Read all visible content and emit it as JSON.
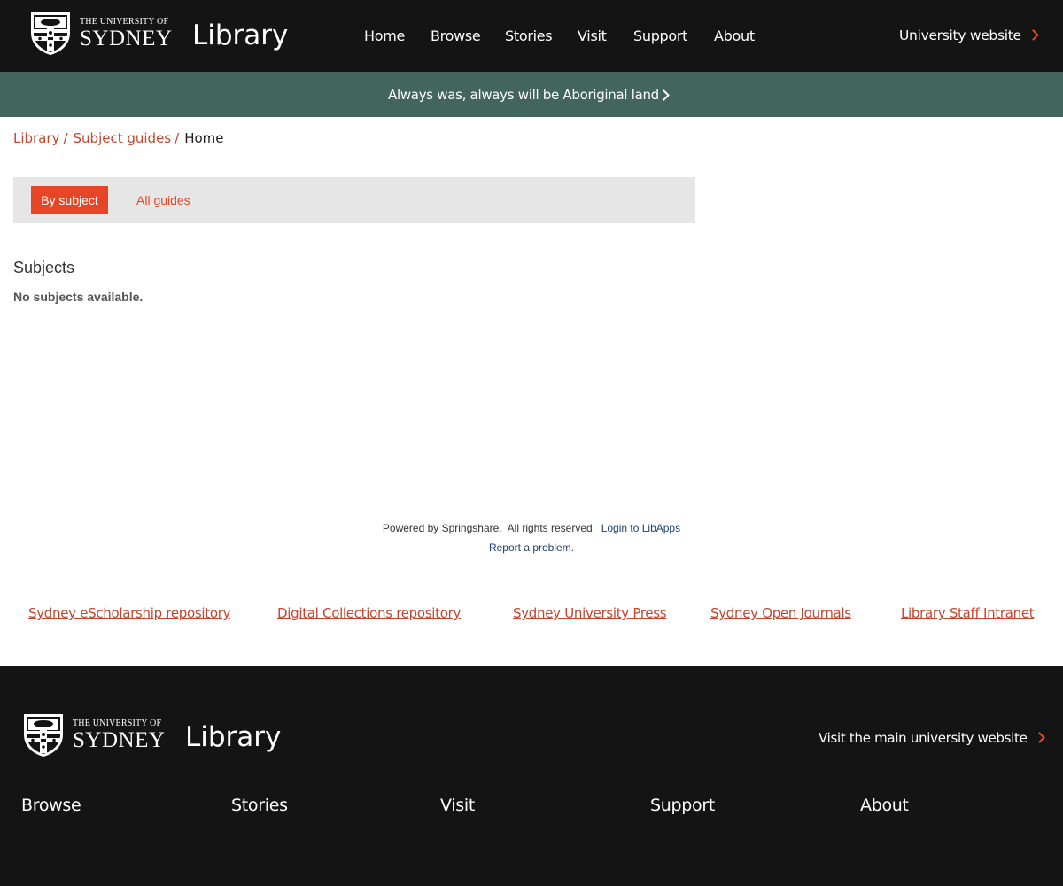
{
  "header": {
    "logo_small": "THE UNIVERSITY OF",
    "logo_big": "SYDNEY",
    "title": "Library",
    "nav": [
      {
        "label": "Home"
      },
      {
        "label": "Browse"
      },
      {
        "label": "Stories"
      },
      {
        "label": "Visit"
      },
      {
        "label": "Support"
      },
      {
        "label": "About"
      }
    ],
    "university_link": "University website"
  },
  "banner": {
    "text": "Always was, always will be Aboriginal land"
  },
  "breadcrumb": {
    "items": [
      "Library",
      "Subject guides"
    ],
    "separator": "/",
    "current": "Home"
  },
  "tabs": {
    "active": "By subject",
    "other": "All guides"
  },
  "subjects": {
    "title": "Subjects",
    "empty_message": "No subjects available."
  },
  "springshare": {
    "powered": "Powered by Springshare.",
    "rights": "All rights reserved.",
    "login": "Login to LibApps",
    "report": "Report a problem."
  },
  "links": [
    {
      "label": "Sydney eScholarship repository"
    },
    {
      "label": "Digital Collections repository"
    },
    {
      "label": "Sydney University Press"
    },
    {
      "label": "Sydney Open Journals"
    },
    {
      "label": "Library Staff Intranet"
    }
  ],
  "footer": {
    "logo_small": "THE UNIVERSITY OF",
    "logo_big": "SYDNEY",
    "title": "Library",
    "visit_link": "Visit the main university website",
    "nav": [
      {
        "label": "Browse"
      },
      {
        "label": "Stories"
      },
      {
        "label": "Visit"
      },
      {
        "label": "Support"
      },
      {
        "label": "About"
      }
    ]
  },
  "colors": {
    "brand_red": "#e64626",
    "header_bg": "#141414",
    "banner_bg": "#42655d",
    "tabs_bg": "#e6e6e6"
  }
}
